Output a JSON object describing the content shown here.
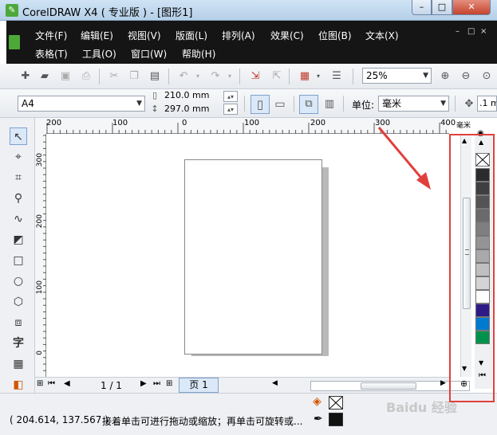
{
  "window": {
    "title": "CorelDRAW X4 ( 专业版 ) - [图形1]",
    "min_label": "–",
    "max_label": "□",
    "close_label": "✕"
  },
  "menus": {
    "row1": [
      "文件(F)",
      "编辑(E)",
      "视图(V)",
      "版面(L)",
      "排列(A)",
      "效果(C)",
      "位图(B)",
      "文本(X)"
    ],
    "row2": [
      "表格(T)",
      "工具(O)",
      "窗口(W)",
      "帮助(H)"
    ],
    "doc_controls": [
      "–",
      "□",
      "×"
    ]
  },
  "toolbar": {
    "zoom": "25%"
  },
  "property_bar": {
    "paper": "A4",
    "width": "210.0 mm",
    "height": "297.0 mm",
    "units_label": "单位:",
    "units_value": "毫米",
    "nudge_value": ".1 m"
  },
  "rulers": {
    "horizontal": [
      "200",
      "100",
      "0",
      "100",
      "200",
      "300",
      "400"
    ],
    "horizontal_unit": "毫米",
    "vertical": [
      "300",
      "200",
      "100",
      "0"
    ]
  },
  "page_nav": {
    "counter": "1 / 1",
    "tab": "页 1"
  },
  "status": {
    "coords": "( 204.614, 137.567 )",
    "hint": "接着单击可进行拖动或缩放；再单击可旋转或..."
  },
  "watermark": "Baidu 经验",
  "colors": {
    "palette": [
      "#2b2b2b",
      "#3f3f3f",
      "#545454",
      "#6a6a6a",
      "#7f7f7f",
      "#949494",
      "#a9a9a9",
      "#bfbfbf",
      "#d4d4d4",
      "#ffffff",
      "#2e1a87",
      "#0079d0",
      "#00924d"
    ],
    "annotation": "#e0403c"
  }
}
